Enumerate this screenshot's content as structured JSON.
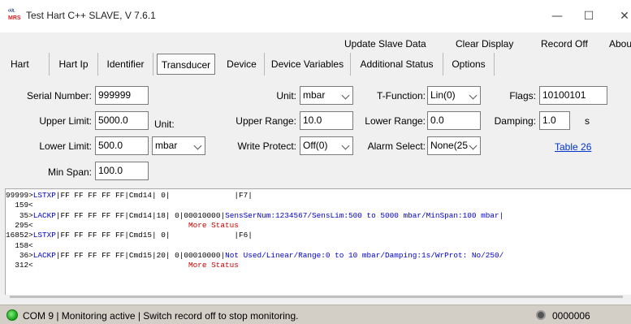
{
  "window": {
    "title": "Test Hart C++ SLAVE, V 7.6.1",
    "app_icon_text_top": "ᵒᵁᴸ",
    "app_icon_text": "MRS",
    "minimize": "—",
    "maximize": "☐",
    "close": "✕"
  },
  "menu": {
    "items": [
      "Update Slave Data",
      "Clear Display",
      "Record Off",
      "About"
    ]
  },
  "tabs": [
    "Hart",
    "Hart Ip",
    "Identifier",
    "Transducer",
    "Device",
    "Device Variables",
    "Additional Status",
    "Options"
  ],
  "active_tab": "Transducer",
  "transducer": {
    "serial_number": {
      "label": "Serial Number:",
      "value": "999999"
    },
    "upper_limit": {
      "label": "Upper Limit:",
      "value": "5000.0"
    },
    "lower_limit": {
      "label": "Lower Limit:",
      "value": "500.0"
    },
    "min_span": {
      "label": "Min Span:",
      "value": "100.0"
    },
    "limit_unit": {
      "label": "Unit:",
      "value": "mbar"
    },
    "unit": {
      "label": "Unit:",
      "value": "mbar"
    },
    "upper_range": {
      "label": "Upper Range:",
      "value": "10.0"
    },
    "write_protect": {
      "label": "Write Protect:",
      "value": "Off(0)"
    },
    "t_function": {
      "label": "T-Function:",
      "value": "Lin(0)"
    },
    "lower_range": {
      "label": "Lower Range:",
      "value": "0.0"
    },
    "alarm_select": {
      "label": "Alarm Select:",
      "value": "None(25"
    },
    "flags": {
      "label": "Flags:",
      "value": "10100101"
    },
    "damping": {
      "label": "Damping:",
      "value": "1.0",
      "unit": "s"
    },
    "table_link": "Table 26"
  },
  "log": {
    "lines": [
      {
        "segments": [
          {
            "text": "99999>",
            "color": "black"
          },
          {
            "text": "LSTXP",
            "color": "blue"
          },
          {
            "text": "|FF FF FF FF FF|Cmd14| 0|              |F7|",
            "color": "black"
          }
        ]
      },
      {
        "segments": [
          {
            "text": "  159<",
            "color": "black"
          }
        ]
      },
      {
        "segments": [
          {
            "text": "   35>",
            "color": "black"
          },
          {
            "text": "LACKP",
            "color": "blue"
          },
          {
            "text": "|FF FF FF FF FF|Cmd14|18| 0|00010000|",
            "color": "black"
          },
          {
            "text": "SensSerNum:1234567/SensLim:500 to 5000 mbar/MinSpan:100 mbar|",
            "color": "blue"
          }
        ]
      },
      {
        "segments": [
          {
            "text": "  295<",
            "color": "black"
          },
          {
            "text": "                                  More Status",
            "color": "red"
          }
        ]
      },
      {
        "segments": [
          {
            "text": "16852>",
            "color": "black"
          },
          {
            "text": "LSTXP",
            "color": "blue"
          },
          {
            "text": "|FF FF FF FF FF|Cmd15| 0|              |F6|",
            "color": "black"
          }
        ]
      },
      {
        "segments": [
          {
            "text": "  158<",
            "color": "black"
          }
        ]
      },
      {
        "segments": [
          {
            "text": "   36>",
            "color": "black"
          },
          {
            "text": "LACKP",
            "color": "blue"
          },
          {
            "text": "|FF FF FF FF FF|Cmd15|20| 0|00010000|",
            "color": "black"
          },
          {
            "text": "Not Used/Linear/Range:0 to 10 mbar/Damping:1s/WrProt: No/250/",
            "color": "blue"
          }
        ]
      },
      {
        "segments": [
          {
            "text": "  312<",
            "color": "black"
          },
          {
            "text": "                                  More Status",
            "color": "red"
          }
        ]
      }
    ]
  },
  "status": {
    "text": "COM 9 | Monitoring active | Switch record off to stop monitoring.",
    "counter": "0000006"
  },
  "colors": {
    "link": "#0033cc",
    "log_blue": "#0000cc",
    "log_red": "#cc0000",
    "status_bg": "#d4cfc6",
    "led_green": "#16a016"
  }
}
